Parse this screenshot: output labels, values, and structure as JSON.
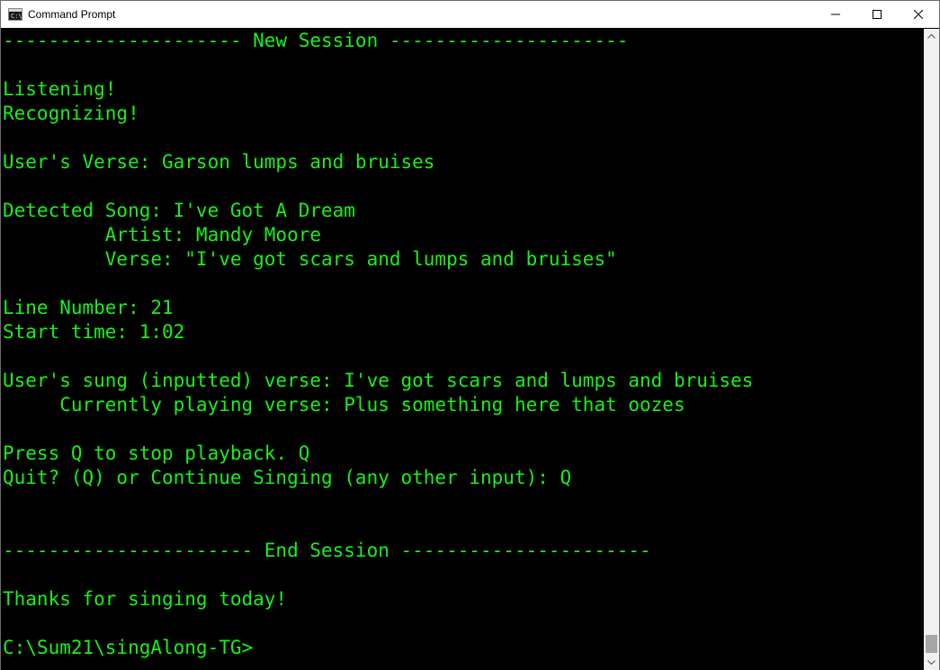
{
  "window": {
    "title": "Command Prompt",
    "icon": "command-prompt-icon",
    "icon_text": "C:\\.",
    "controls": {
      "minimize_icon": "minimize-icon",
      "maximize_icon": "maximize-icon",
      "close_icon": "close-icon"
    }
  },
  "colors": {
    "background": "#000000",
    "text": "#19f019",
    "titlebar": "#ffffff"
  },
  "console": {
    "lines": [
      "--------------------- New Session ---------------------",
      "",
      "Listening!",
      "Recognizing!",
      "",
      "User's Verse: Garson lumps and bruises",
      "",
      "Detected Song: I've Got A Dream",
      "         Artist: Mandy Moore",
      "         Verse: \"I've got scars and lumps and bruises\"",
      "",
      "Line Number: 21",
      "Start time: 1:02",
      "",
      "User's sung (inputted) verse: I've got scars and lumps and bruises",
      "     Currently playing verse: Plus something here that oozes",
      "",
      "Press Q to stop playback. Q",
      "Quit? (Q) or Continue Singing (any other input): Q",
      "",
      "",
      "---------------------- End Session ----------------------",
      "",
      "Thanks for singing today!",
      "",
      "C:\\Sum21\\singAlong-TG>"
    ]
  }
}
